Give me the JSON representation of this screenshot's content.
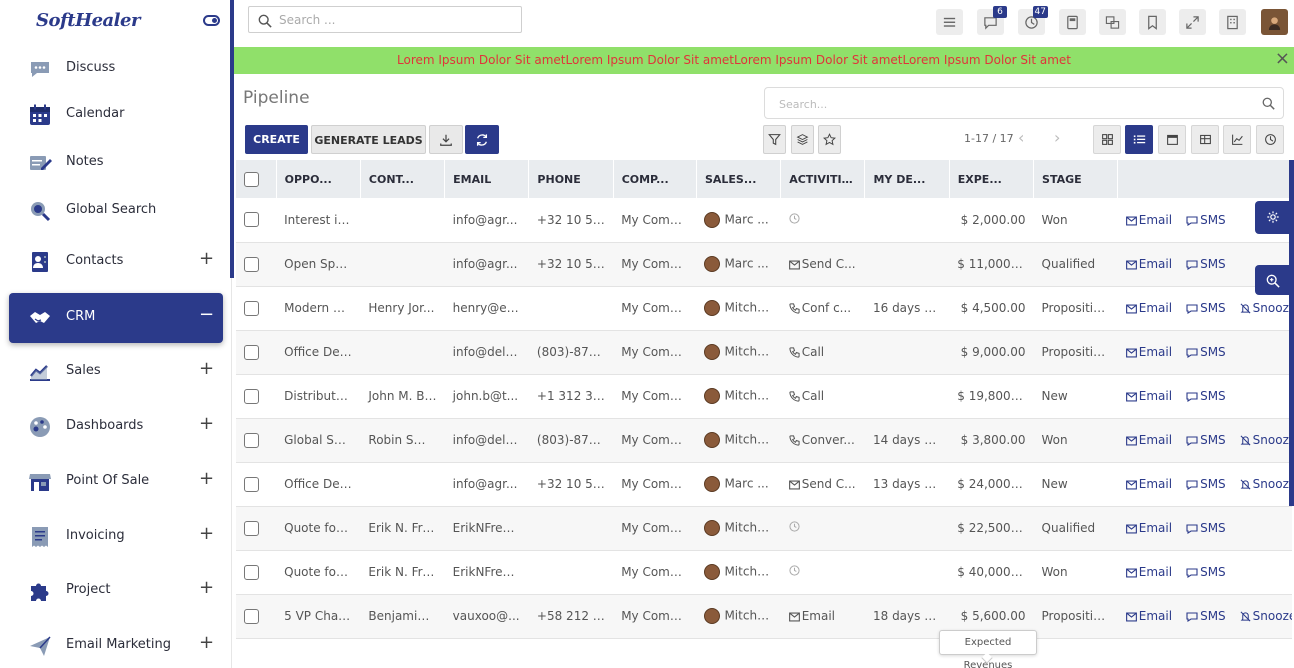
{
  "app": {
    "logo": "SoftHealer"
  },
  "sidebar": {
    "items": [
      {
        "label": "Discuss",
        "icon": "chat-bubble-icon",
        "expand": ""
      },
      {
        "label": "Calendar",
        "icon": "calendar-icon",
        "expand": ""
      },
      {
        "label": "Notes",
        "icon": "notes-icon",
        "expand": ""
      },
      {
        "label": "Global Search",
        "icon": "global-search-icon",
        "expand": ""
      },
      {
        "label": "Contacts",
        "icon": "contacts-icon",
        "expand": "+"
      },
      {
        "label": "CRM",
        "icon": "handshake-icon",
        "expand": "−"
      },
      {
        "label": "Sales",
        "icon": "trend-chart-icon",
        "expand": "+"
      },
      {
        "label": "Dashboards",
        "icon": "palette-icon",
        "expand": "+"
      },
      {
        "label": "Point Of Sale",
        "icon": "store-icon",
        "expand": "+"
      },
      {
        "label": "Invoicing",
        "icon": "receipt-icon",
        "expand": "+"
      },
      {
        "label": "Project",
        "icon": "puzzle-icon",
        "expand": "+"
      },
      {
        "label": "Email Marketing",
        "icon": "paper-plane-icon",
        "expand": "+"
      }
    ],
    "active": "CRM"
  },
  "topbar": {
    "search_placeholder": "Search ...",
    "messages_badge": "6",
    "activities_badge": "47"
  },
  "announcement": {
    "text": "Lorem Ipsum Dolor Sit ametLorem Ipsum Dolor Sit ametLorem Ipsum Dolor Sit ametLorem Ipsum Dolor Sit amet",
    "close": "×",
    "bg_color": "#90e06a",
    "text_color": "#e0343a"
  },
  "control": {
    "title": "Pipeline",
    "search_placeholder": "Search...",
    "create_label": "CREATE",
    "generate_label": "GENERATE LEADS",
    "pager": "1-17 / 17",
    "prev": "‹",
    "next": "›"
  },
  "table": {
    "headers": [
      "OPPO...",
      "CONT...",
      "EMAIL",
      "PHONE",
      "COMP...",
      "SALES...",
      "ACTIVITIES",
      "MY DE...",
      "EXPE...",
      "STAGE"
    ],
    "rows": [
      {
        "opp": "Interest in...",
        "contact": "",
        "email": "info@agr...",
        "phone": "+32 10 588...",
        "company": "My Comp...",
        "sales": "Marc ...",
        "activity": "",
        "activity_type": "clock",
        "deadline": "",
        "revenue": "$ 2,000.00",
        "stage": "Won",
        "snooze": ""
      },
      {
        "opp": "Open Spa...",
        "contact": "",
        "email": "info@agr...",
        "phone": "+32 10 588...",
        "company": "My Comp...",
        "sales": "Marc ...",
        "activity": "Send C...",
        "activity_type": "mail",
        "deadline": "",
        "revenue": "$ 11,000.00",
        "stage": "Qualified",
        "snooze": ""
      },
      {
        "opp": "Modern O...",
        "contact": "Henry Jor...",
        "email": "henry@eli...",
        "phone": "",
        "company": "My Comp...",
        "sales": "Mitche...",
        "activity": "Conf c...",
        "activity_type": "phone",
        "deadline": "16 days ago...",
        "revenue": "$ 4,500.00",
        "stage": "Propositio...",
        "snooze": "Snooze"
      },
      {
        "opp": "Office Des...",
        "contact": "",
        "email": "info@delt...",
        "phone": "(803)-873...",
        "company": "My Comp...",
        "sales": "Mitche...",
        "activity": "Call",
        "activity_type": "phone",
        "deadline": "",
        "revenue": "$ 9,000.00",
        "stage": "Propositio...",
        "snooze": ""
      },
      {
        "opp": "Distributo...",
        "contact": "John M. Br...",
        "email": "john.b@t...",
        "phone": "+1 312 349 ...",
        "company": "My Comp...",
        "sales": "Mitche...",
        "activity": "Call",
        "activity_type": "phone",
        "deadline": "",
        "revenue": "$ 19,800.00",
        "stage": "New",
        "snooze": ""
      },
      {
        "opp": "Global Sol...",
        "contact": "Robin Smi...",
        "email": "info@delt...",
        "phone": "(803)-873...",
        "company": "My Comp...",
        "sales": "Mitche...",
        "activity": "Conver...",
        "activity_type": "phone",
        "deadline": "14 days ago...",
        "revenue": "$ 3,800.00",
        "stage": "Won",
        "snooze": "Snooze"
      },
      {
        "opp": "Office Des...",
        "contact": "",
        "email": "info@agr...",
        "phone": "+32 10 588...",
        "company": "My Comp...",
        "sales": "Marc ...",
        "activity": "Send C...",
        "activity_type": "mail",
        "deadline": "13 days ago...",
        "revenue": "$ 24,000.00",
        "stage": "New",
        "snooze": "Snooze"
      },
      {
        "opp": "Quote for ...",
        "contact": "Erik N. Fren...",
        "email": "ErikNFrenc...",
        "phone": "",
        "company": "My Comp...",
        "sales": "Mitche...",
        "activity": "",
        "activity_type": "clock",
        "deadline": "",
        "revenue": "$ 22,500.00",
        "stage": "Qualified",
        "snooze": ""
      },
      {
        "opp": "Quote for ...",
        "contact": "Erik N. Fren...",
        "email": "ErikNFrenc...",
        "phone": "",
        "company": "My Comp...",
        "sales": "Mitche...",
        "activity": "",
        "activity_type": "clock",
        "deadline": "",
        "revenue": "$ 40,000.00",
        "stage": "Won",
        "snooze": ""
      },
      {
        "opp": "5 VP Chairs",
        "contact": "Benjamin ...",
        "email": "vauxoo@...",
        "phone": "+58 212 68...",
        "company": "My Comp...",
        "sales": "Mitche...",
        "activity": "Email",
        "activity_type": "mail",
        "deadline": "18 days ago...",
        "revenue": "$ 5,600.00",
        "stage": "Propositio...",
        "snooze": "Snooze"
      }
    ],
    "email_label": "Email",
    "sms_label": "SMS"
  },
  "tooltip": {
    "text": "Expected Revenues"
  },
  "colors": {
    "brand": "#2b3a8a",
    "danger": "#dd3333"
  }
}
